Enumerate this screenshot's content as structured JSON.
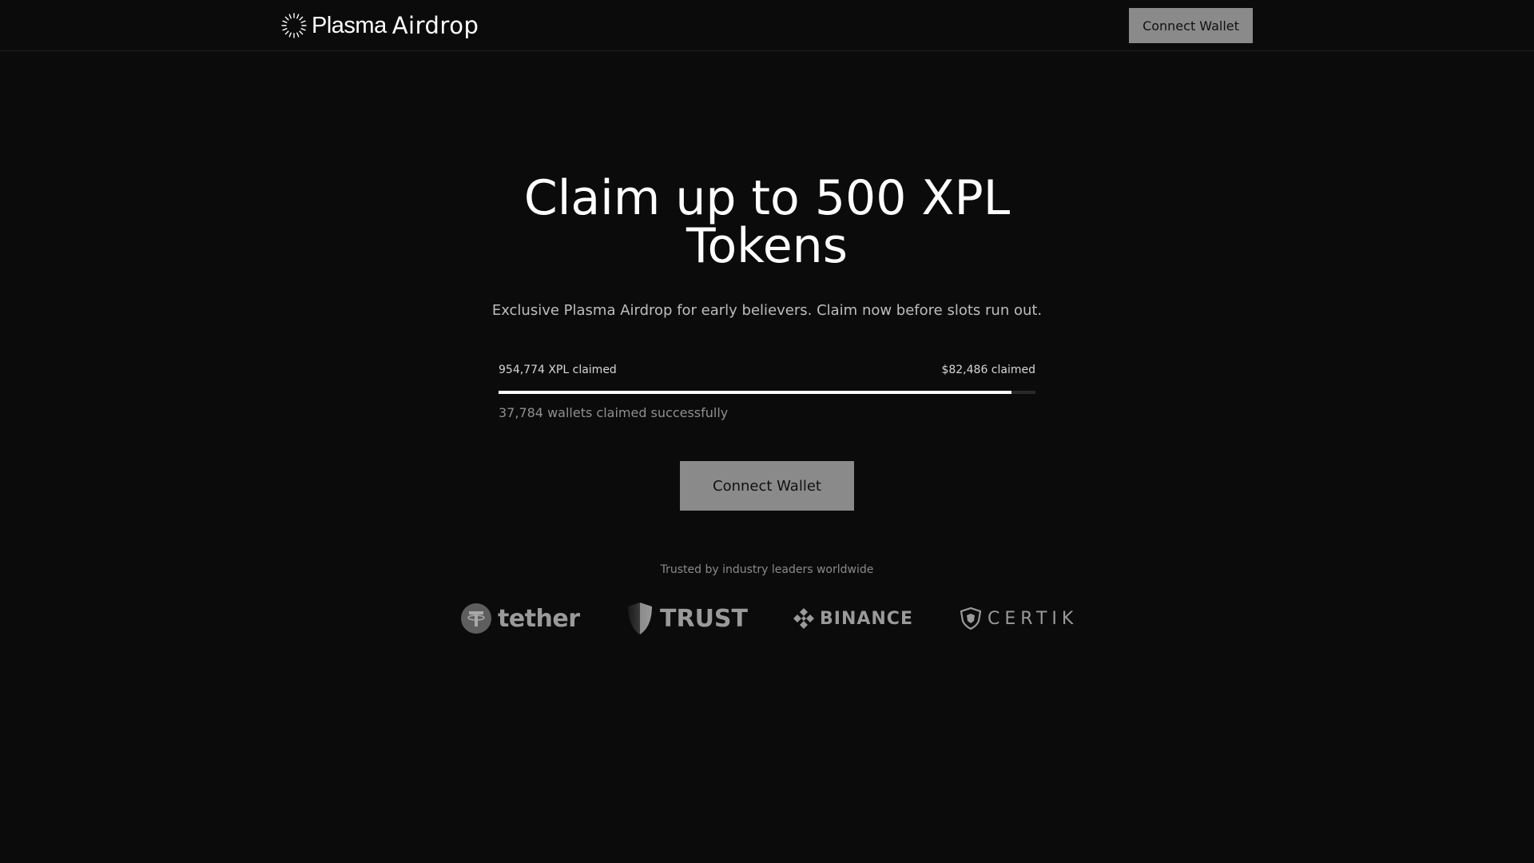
{
  "header": {
    "brand_word1": "Plasma",
    "brand_word2": "Airdrop",
    "connect_label": "Connect Wallet"
  },
  "hero": {
    "title_line1": "Claim up to 500 XPL",
    "title_line2": "Tokens",
    "subtitle": "Exclusive Plasma Airdrop for early believers. Claim now before slots run out."
  },
  "progress": {
    "left_label": "954,774 XPL claimed",
    "right_label": "$82,486 claimed",
    "fill_fraction": 0.955,
    "wallets_text": "37,784 wallets claimed successfully"
  },
  "cta": {
    "connect_label": "Connect Wallet"
  },
  "trusted": {
    "heading": "Trusted by industry leaders worldwide",
    "logos": [
      {
        "name": "tether",
        "icon": "tether-logo-icon"
      },
      {
        "name": "TRUST",
        "icon": "trust-shield-icon"
      },
      {
        "name": "BINANCE",
        "icon": "binance-diamond-icon"
      },
      {
        "name": "CERTIK",
        "icon": "certik-shield-icon"
      }
    ]
  },
  "colors": {
    "background": "#0b0b0b",
    "button_bg": "#8a8a8a",
    "button_text": "#111111",
    "progress_fill": "#ffffff",
    "progress_track": "#2a2a2a",
    "logo_gray": "#9a9a9a"
  }
}
